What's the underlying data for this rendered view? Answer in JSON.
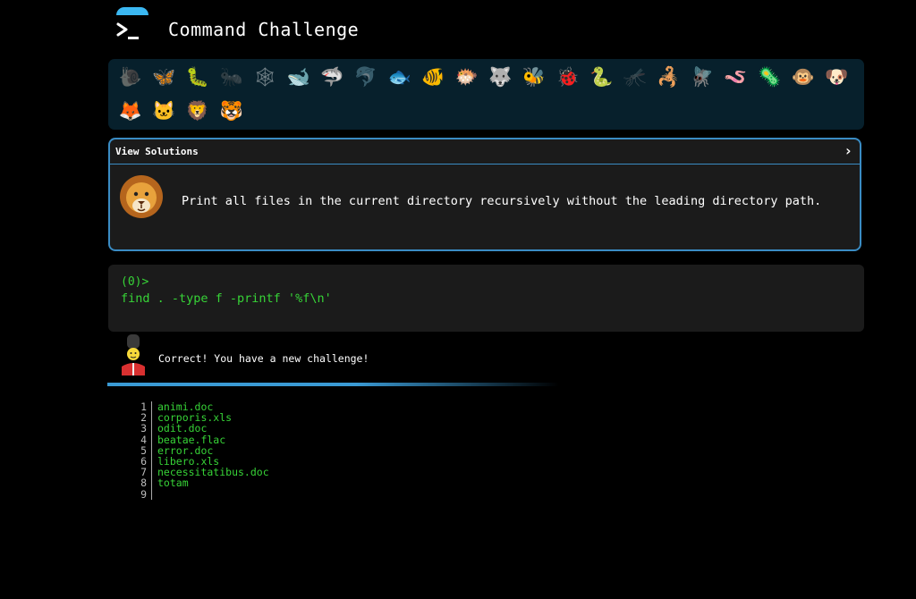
{
  "header": {
    "title": "Command Challenge",
    "logo_icon": "terminal-prompt-icon",
    "accent_color": "#3bb8f2"
  },
  "icon_bar": {
    "row1": [
      {
        "name": "snail",
        "glyph": "🐌",
        "dim": true
      },
      {
        "name": "butterfly",
        "glyph": "🦋",
        "dim": false
      },
      {
        "name": "caterpillar",
        "glyph": "🐛",
        "dim": false
      },
      {
        "name": "ant",
        "glyph": "🐜",
        "dim": true
      },
      {
        "name": "spider-web",
        "glyph": "🕸",
        "dim": true
      },
      {
        "name": "whale",
        "glyph": "🐋",
        "dim": false
      },
      {
        "name": "shark",
        "glyph": "🦈",
        "dim": false
      },
      {
        "name": "dolphin",
        "glyph": "🐬",
        "dim": true
      },
      {
        "name": "fish",
        "glyph": "🐟",
        "dim": false
      },
      {
        "name": "tropical-fish",
        "glyph": "🐠",
        "dim": false
      },
      {
        "name": "blowfish",
        "glyph": "🐡",
        "dim": false
      },
      {
        "name": "wolf",
        "glyph": "🐺",
        "dim": false
      },
      {
        "name": "bee",
        "glyph": "🐝",
        "dim": false
      },
      {
        "name": "ladybug",
        "glyph": "🐞",
        "dim": false
      },
      {
        "name": "worm",
        "glyph": "🐍",
        "dim": false
      },
      {
        "name": "mosquito",
        "glyph": "🦟",
        "dim": true
      },
      {
        "name": "scorpion",
        "glyph": "🦂",
        "dim": false
      },
      {
        "name": "fly",
        "glyph": "🪰",
        "dim": false
      },
      {
        "name": "earthworm",
        "glyph": "🪱",
        "dim": false
      },
      {
        "name": "microbe",
        "glyph": "🦠",
        "dim": false
      },
      {
        "name": "monkey",
        "glyph": "🐵",
        "dim": false
      },
      {
        "name": "dog",
        "glyph": "🐶",
        "dim": false
      }
    ],
    "row2": [
      {
        "name": "fox",
        "glyph": "🦊",
        "dim": false
      },
      {
        "name": "cat",
        "glyph": "🐱",
        "dim": false
      },
      {
        "name": "lion",
        "glyph": "🦁",
        "dim": false
      },
      {
        "name": "tiger",
        "glyph": "🐯",
        "dim": false
      }
    ]
  },
  "solution": {
    "header_label": "View Solutions",
    "chevron_icon": "chevron-right-icon",
    "avatar_icon": "lion-icon",
    "challenge_text": "Print all files in the current directory recursively without the leading directory path."
  },
  "terminal": {
    "prompt": "(0)>",
    "command": "find . -type f -printf '%f\\n'",
    "text_color": "#37d437"
  },
  "feedback": {
    "avatar_icon": "royal-guard-icon",
    "message": "Correct! You have a new challenge!"
  },
  "output": {
    "lines": [
      {
        "n": "1",
        "text": "animi.doc"
      },
      {
        "n": "2",
        "text": "corporis.xls"
      },
      {
        "n": "3",
        "text": "odit.doc"
      },
      {
        "n": "4",
        "text": "beatae.flac"
      },
      {
        "n": "5",
        "text": "error.doc"
      },
      {
        "n": "6",
        "text": "libero.xls"
      },
      {
        "n": "7",
        "text": "necessitatibus.doc"
      },
      {
        "n": "8",
        "text": "totam"
      },
      {
        "n": "9",
        "text": ""
      }
    ]
  }
}
